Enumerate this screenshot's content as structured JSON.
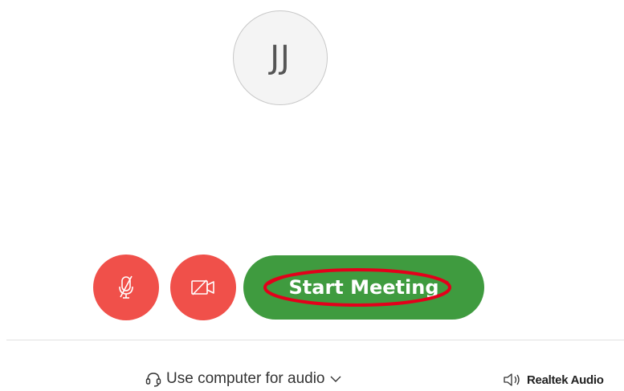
{
  "avatar": {
    "initials": "JJ"
  },
  "controls": {
    "mute_icon": "microphone-muted-icon",
    "video_icon": "video-off-icon",
    "start_label": "Start Meeting"
  },
  "audio": {
    "icon": "headset-icon",
    "selected_option": "Use computer for audio",
    "chevron_icon": "chevron-down-icon"
  },
  "speaker": {
    "icon": "speaker-icon",
    "device": "Realtek Audio"
  },
  "colors": {
    "mute_button": "#f0504a",
    "video_button": "#f0504a",
    "start_button": "#3f9b3f",
    "annotation_ring": "#e3001b"
  }
}
